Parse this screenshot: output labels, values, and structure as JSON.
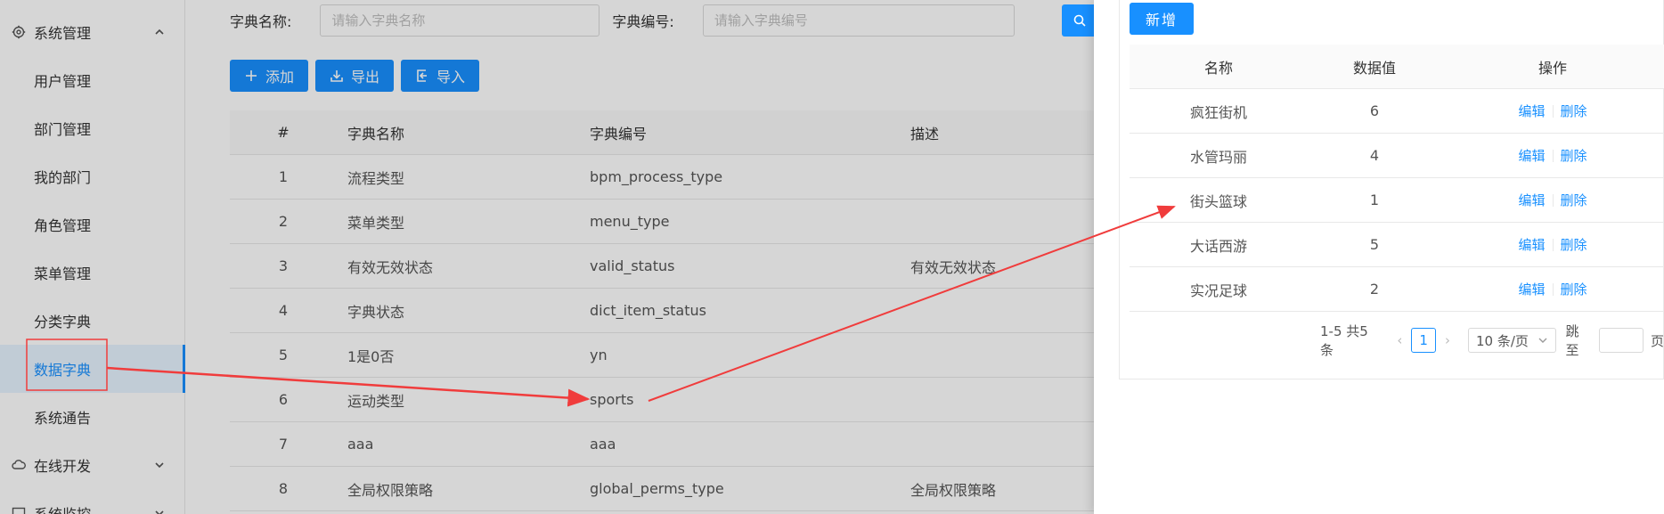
{
  "sidebar": {
    "groups": [
      {
        "label": "系统管理",
        "icon": "gear-icon",
        "expanded": true
      },
      {
        "label": "在线开发",
        "icon": "cloud-icon",
        "expanded": false
      },
      {
        "label": "系统监控",
        "icon": "monitor-icon",
        "expanded": false
      }
    ],
    "items": [
      {
        "label": "用户管理"
      },
      {
        "label": "部门管理"
      },
      {
        "label": "我的部门"
      },
      {
        "label": "角色管理"
      },
      {
        "label": "菜单管理"
      },
      {
        "label": "分类字典"
      },
      {
        "label": "数据字典",
        "active": true
      },
      {
        "label": "系统通告"
      }
    ]
  },
  "search": {
    "name_label": "字典名称:",
    "name_placeholder": "请输入字典名称",
    "code_label": "字典编号:",
    "code_placeholder": "请输入字典编号"
  },
  "toolbar": {
    "add_label": "添加",
    "export_label": "导出",
    "import_label": "导入"
  },
  "dict_table": {
    "headers": [
      "#",
      "字典名称",
      "字典编号",
      "描述"
    ],
    "rows": [
      {
        "no": "1",
        "name": "流程类型",
        "code": "bpm_process_type",
        "desc": ""
      },
      {
        "no": "2",
        "name": "菜单类型",
        "code": "menu_type",
        "desc": ""
      },
      {
        "no": "3",
        "name": "有效无效状态",
        "code": "valid_status",
        "desc": "有效无效状态"
      },
      {
        "no": "4",
        "name": "字典状态",
        "code": "dict_item_status",
        "desc": ""
      },
      {
        "no": "5",
        "name": "1是0否",
        "code": "yn",
        "desc": ""
      },
      {
        "no": "6",
        "name": "运动类型",
        "code": "sports",
        "desc": ""
      },
      {
        "no": "7",
        "name": "aaa",
        "code": "aaa",
        "desc": ""
      },
      {
        "no": "8",
        "name": "全局权限策略",
        "code": "global_perms_type",
        "desc": "全局权限策略"
      }
    ]
  },
  "panel": {
    "new_label": "新增",
    "headers": [
      "名称",
      "数据值",
      "操作"
    ],
    "rows": [
      {
        "name": "疯狂街机",
        "value": "6"
      },
      {
        "name": "水管玛丽",
        "value": "4"
      },
      {
        "name": "街头篮球",
        "value": "1"
      },
      {
        "name": "大话西游",
        "value": "5"
      },
      {
        "name": "实况足球",
        "value": "2"
      }
    ],
    "edit_label": "编辑",
    "delete_label": "删除",
    "pagination": {
      "summary": "1-5 共5条",
      "current_page": "1",
      "page_size": "10 条/页",
      "jump_label": "跳至",
      "page_suffix": "页"
    }
  },
  "colors": {
    "primary": "#1890ff",
    "annotation": "#f03c3c"
  }
}
